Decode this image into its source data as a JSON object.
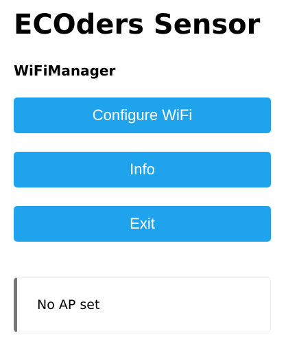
{
  "header": {
    "title": "ECOders Sensor",
    "subtitle": "WiFiManager"
  },
  "menu": {
    "configure_wifi_label": "Configure WiFi",
    "info_label": "Info",
    "exit_label": "Exit"
  },
  "status": {
    "message": "No AP set"
  },
  "colors": {
    "button_background": "#1fa3ec",
    "button_text": "#ffffff",
    "message_border_accent": "#777777"
  }
}
